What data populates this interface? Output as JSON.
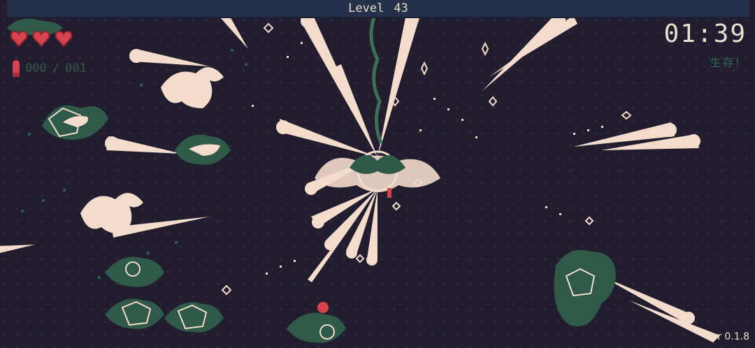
{
  "hud": {
    "level_label": "Level",
    "level_value": "43",
    "hearts": 3,
    "ammo_current": "000",
    "ammo_separator": "/",
    "ammo_max": "001",
    "timer": "01:39",
    "status_text": "生存!",
    "version": "ver 0.1.8"
  },
  "colors": {
    "background": "#221d2e",
    "bullet": "#f3dccb",
    "enemy_green": "#2f5a49",
    "heart": "#d6444f",
    "topbar": "#25304a"
  },
  "icons": [
    "heart-icon",
    "bullet-icon",
    "target-crosshair-icon"
  ]
}
